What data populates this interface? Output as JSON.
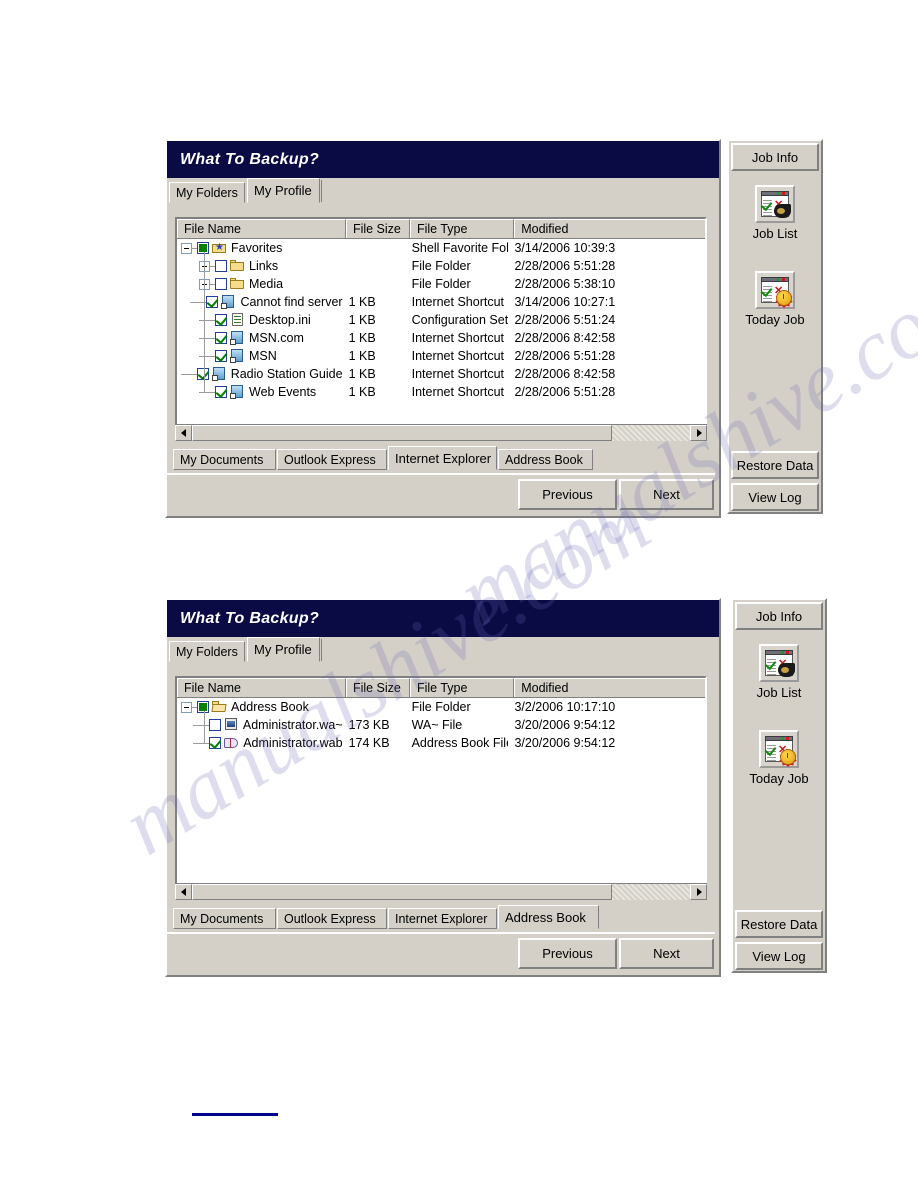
{
  "watermark": {
    "text_left": "manualshive.com",
    "text_right": "manualshive.com"
  },
  "columns": [
    "File Name",
    "File Size",
    "File Type",
    "Modified"
  ],
  "sidebar": {
    "job_info_label": "Job Info",
    "job_list_label": "Job List",
    "today_job_label": "Today Job",
    "restore_data_label": "Restore Data",
    "view_log_label": "View Log",
    "job_list_icon": "job-list-icon",
    "today_job_icon": "today-job-icon"
  },
  "footer": {
    "previous_label": "Previous",
    "next_label": "Next"
  },
  "category_tabs": [
    "My Documents",
    "Outlook Express",
    "Internet Explorer",
    "Address Book"
  ],
  "top_tabs": [
    "My Folders",
    "My Profile"
  ],
  "panel1": {
    "title": "What To Backup?",
    "active_top_tab": "My Profile",
    "active_category_tab": "Internet Explorer",
    "rows": [
      {
        "indent": 0,
        "twisty": "minus",
        "check": "full",
        "icon": "favorites-folder-icon",
        "name": "Favorites",
        "size": "",
        "type": "Shell Favorite Fol...",
        "modified": "3/14/2006 10:39:3"
      },
      {
        "indent": 1,
        "twisty": "plus",
        "check": "empty",
        "icon": "folder-icon",
        "name": "Links",
        "size": "",
        "type": "File Folder",
        "modified": "2/28/2006 5:51:28"
      },
      {
        "indent": 1,
        "twisty": "plus",
        "check": "empty",
        "icon": "folder-icon",
        "name": "Media",
        "size": "",
        "type": "File Folder",
        "modified": "2/28/2006 5:38:10"
      },
      {
        "indent": 1,
        "twisty": "none",
        "check": "tick",
        "icon": "internet-shortcut-icon",
        "name": "Cannot find server",
        "size": "1 KB",
        "type": "Internet Shortcut",
        "modified": "3/14/2006 10:27:1"
      },
      {
        "indent": 1,
        "twisty": "none",
        "check": "tick",
        "icon": "ini-file-icon",
        "name": "Desktop.ini",
        "size": "1 KB",
        "type": "Configuration Sett...",
        "modified": "2/28/2006 5:51:24"
      },
      {
        "indent": 1,
        "twisty": "none",
        "check": "tick",
        "icon": "internet-shortcut-icon",
        "name": "MSN.com",
        "size": "1 KB",
        "type": "Internet Shortcut",
        "modified": "2/28/2006 8:42:58"
      },
      {
        "indent": 1,
        "twisty": "none",
        "check": "tick",
        "icon": "internet-shortcut-icon",
        "name": "MSN",
        "size": "1 KB",
        "type": "Internet Shortcut",
        "modified": "2/28/2006 5:51:28"
      },
      {
        "indent": 1,
        "twisty": "none",
        "check": "tick",
        "icon": "internet-shortcut-icon",
        "name": "Radio Station Guide",
        "size": "1 KB",
        "type": "Internet Shortcut",
        "modified": "2/28/2006 8:42:58"
      },
      {
        "indent": 1,
        "twisty": "none",
        "check": "tick",
        "icon": "internet-shortcut-icon",
        "name": "Web Events",
        "size": "1 KB",
        "type": "Internet Shortcut",
        "modified": "2/28/2006 5:51:28"
      }
    ]
  },
  "panel2": {
    "title": "What To Backup?",
    "active_top_tab": "My Profile",
    "active_category_tab": "Address Book",
    "rows": [
      {
        "indent": 0,
        "twisty": "minus",
        "check": "full",
        "icon": "open-folder-icon",
        "name": "Address Book",
        "size": "",
        "type": "File Folder",
        "modified": "3/2/2006 10:17:10"
      },
      {
        "indent": 1,
        "twisty": "none",
        "check": "empty",
        "icon": "wa-file-icon",
        "name": "Administrator.wa~",
        "size": "173 KB",
        "type": "WA~ File",
        "modified": "3/20/2006 9:54:12"
      },
      {
        "indent": 1,
        "twisty": "none",
        "check": "tick",
        "icon": "address-book-file-icon",
        "name": "Administrator.wab",
        "size": "174 KB",
        "type": "Address Book File",
        "modified": "3/20/2006 9:54:12"
      }
    ]
  }
}
